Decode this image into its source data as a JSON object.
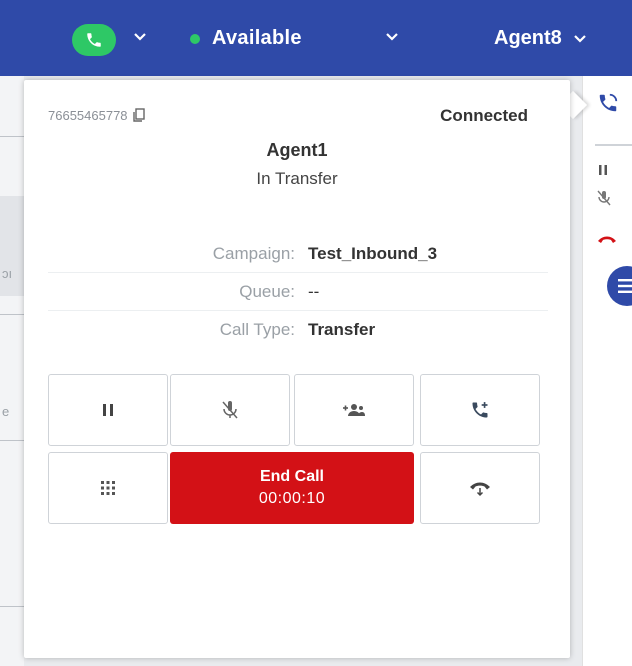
{
  "topbar": {
    "status_label": "Available",
    "agent_label": "Agent8",
    "colors": {
      "bar": "#2f4aa8",
      "phone": "#2ec866",
      "status_dot": "#2ec866"
    }
  },
  "call_panel": {
    "caller_number": "76655465778",
    "connection_status": "Connected",
    "agent_name": "Agent1",
    "agent_state": "In Transfer",
    "details": [
      {
        "label": "Campaign:",
        "value": "Test_Inbound_3"
      },
      {
        "label": "Queue:",
        "value": "--"
      },
      {
        "label": "Call Type:",
        "value": "Transfer"
      }
    ],
    "end_call": {
      "label": "End Call",
      "timer": "00:00:10",
      "color": "#d31116"
    },
    "control_icons": [
      "pause-icon",
      "mute-icon",
      "add-participant-icon",
      "transfer-call-icon",
      "dialpad-icon",
      "hold-phone-icon"
    ]
  },
  "side_strip": {
    "icons": [
      "phone-call-icon",
      "pause-icon",
      "mute-icon",
      "hangup-icon",
      "menu-icon"
    ]
  }
}
